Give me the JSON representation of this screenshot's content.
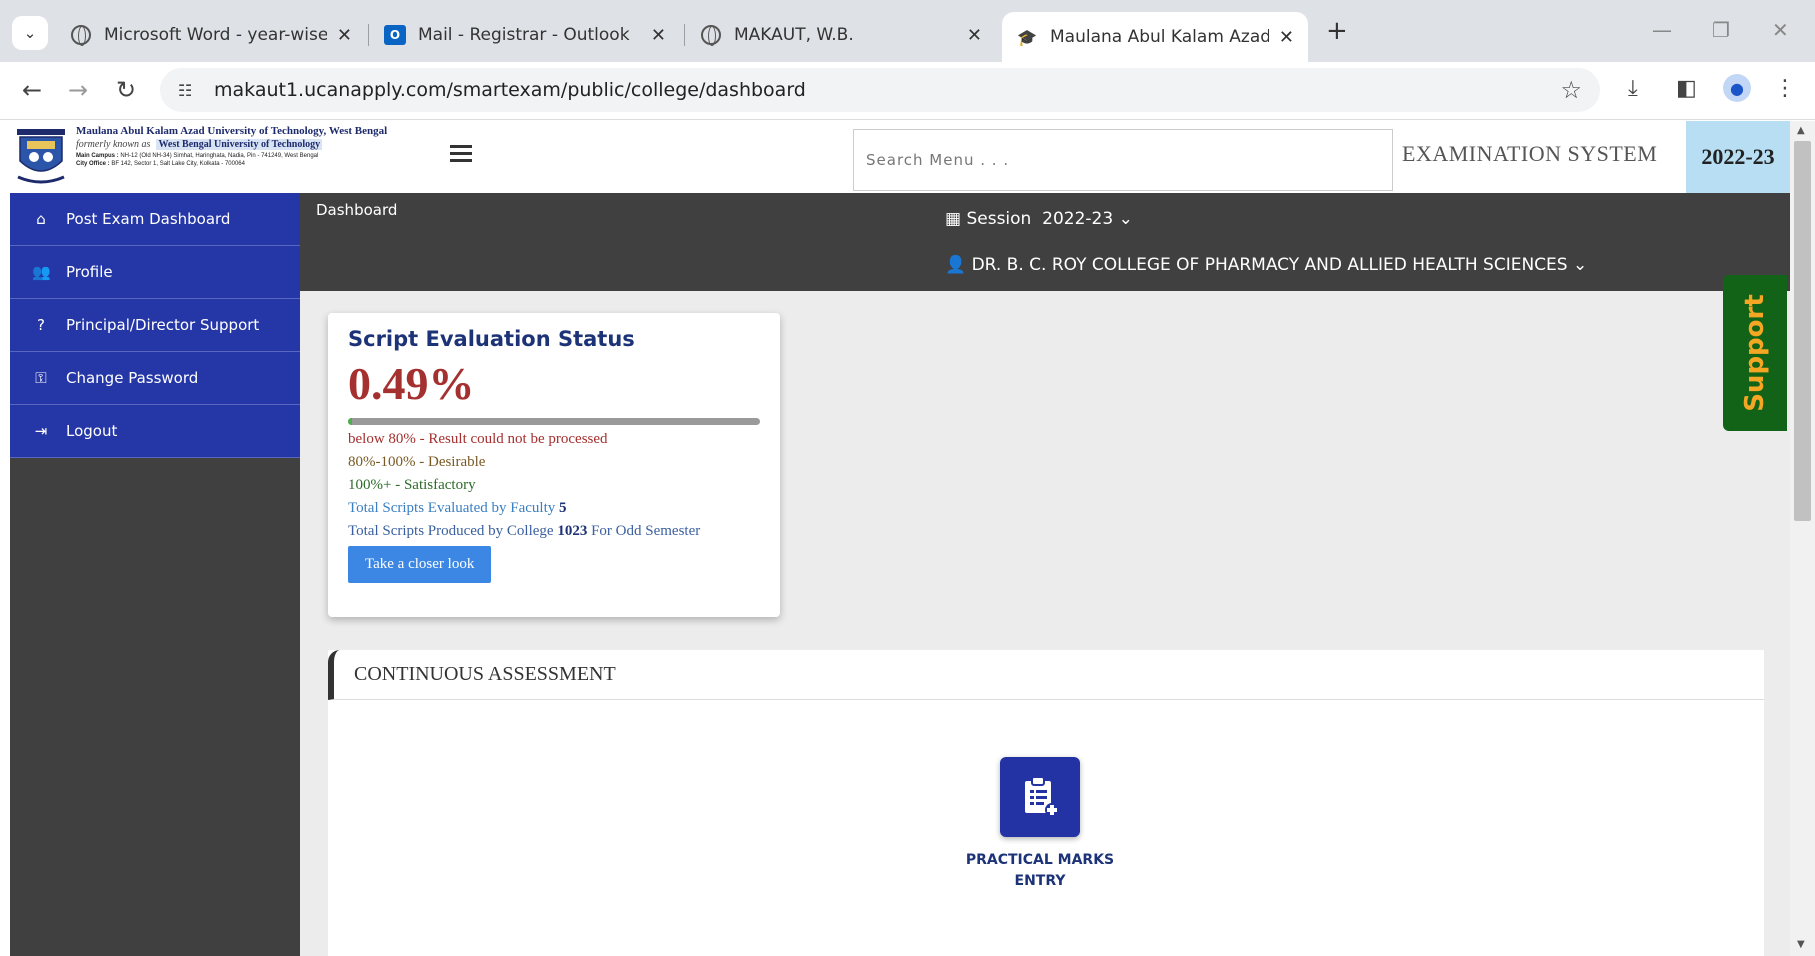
{
  "browser": {
    "tabs": [
      {
        "label": "Microsoft Word - year-wise imp",
        "icon": "globe-icon"
      },
      {
        "label": "Mail - Registrar - Outlook",
        "icon": "outlook-icon"
      },
      {
        "label": "MAKAUT, W.B.",
        "icon": "globe-icon"
      },
      {
        "label": "Maulana Abul Kalam Azad Univ",
        "icon": "graduation-cap-icon"
      }
    ],
    "url": "makaut1.ucanapply.com/smartexam/public/college/dashboard"
  },
  "header": {
    "university_name": "Maulana Abul Kalam Azad University of Technology, West Bengal",
    "formerly_prefix": "formerly known as",
    "formerly_name": "West Bengal University of Technology",
    "main_campus_label": "Main Campus :",
    "main_campus": "NH-12 (Old NH-34) Simhat, Haringhata, Nadia, Pin - 741249, West Bengal",
    "city_office_label": "City Office :",
    "city_office": "BF 142, Sector 1, Salt Lake City, Kolkata - 700064",
    "search_placeholder": "Search Menu . . .",
    "system_title": "EXAMINATION SYSTEM",
    "year": "2022-23"
  },
  "sidebar": {
    "items": [
      {
        "label": "Post Exam Dashboard",
        "icon": "home-icon"
      },
      {
        "label": "Profile",
        "icon": "users-icon"
      },
      {
        "label": "Principal/Director Support",
        "icon": "question-circle-icon"
      },
      {
        "label": "Change Password",
        "icon": "key-icon"
      },
      {
        "label": "Logout",
        "icon": "sign-out-icon"
      }
    ]
  },
  "topbar": {
    "breadcrumb": "Dashboard",
    "session_label": "Session",
    "session_value": "2022-23",
    "college": "DR. B. C. ROY COLLEGE OF PHARMACY AND ALLIED HEALTH SCIENCES"
  },
  "script_status": {
    "title": "Script Evaluation Status",
    "percent": "0.49%",
    "progress_fraction": 0.0049,
    "legend_below": "below 80% - Result could not be processed",
    "legend_desirable": "80%-100% - Desirable",
    "legend_satisfactory": "100%+ - Satisfactory",
    "evaluated_label": "Total Scripts Evaluated by Faculty",
    "evaluated_count": "5",
    "produced_label": "Total Scripts Produced by College",
    "produced_count": "1023",
    "produced_suffix": "For Odd Semester",
    "button": "Take a closer look"
  },
  "continuous_assessment": {
    "title": "CONTINUOUS ASSESSMENT",
    "tile_label": "PRACTICAL MARKS ENTRY",
    "tile_icon": "clipboard-icon"
  },
  "support_tab": "Support",
  "colors": {
    "sidebar_blue": "#2537a7",
    "percent_red": "#a4302f",
    "support_green": "#126317",
    "support_text": "#f5a623",
    "button_blue": "#3b87e3"
  }
}
